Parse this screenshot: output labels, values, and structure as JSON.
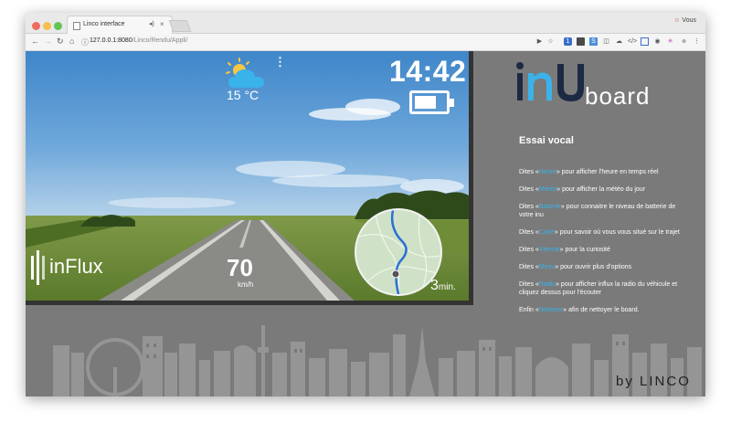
{
  "browser": {
    "tab_title": "Linco interface",
    "profile_label": "Vous",
    "url_host": "127.0.0.1:8080",
    "url_path": "/Linco/Rendu/Appli/"
  },
  "video": {
    "temperature": "15 °C",
    "clock": "14:42",
    "battery_level": 0.72,
    "speed": "70",
    "speed_unit": "km/h",
    "app_name": "inFlux",
    "eta_value": "3",
    "eta_unit": "min.",
    "weather_icon": "partly-cloudy-icon"
  },
  "sidebar": {
    "brand_suffix": "board",
    "title": "Essai vocal",
    "commands": [
      {
        "pre": "Dites «",
        "kw": "Heure",
        "post": "» pour afficher l'heure en temps réel"
      },
      {
        "pre": "Dites «",
        "kw": "Météo",
        "post": "» pour afficher la météo du jour"
      },
      {
        "pre": "Dites «",
        "kw": "Batterie",
        "post": "» pour connaitre le niveau de batterie de votre inu"
      },
      {
        "pre": "Dites «",
        "kw": "Carte",
        "post": "» pour savoir où vous vous situé sur le trajet"
      },
      {
        "pre": "Dites «",
        "kw": "Vitesse",
        "post": "» pour la curiosité"
      },
      {
        "pre": "Dites «",
        "kw": "Menu",
        "post": "» pour ouvrir plus d'options"
      },
      {
        "pre": "Dites «",
        "kw": "Radio",
        "post": "» pour afficher influx la radio du véhicule et cliquez dessus pour l'écouter"
      },
      {
        "pre": "Enfin «",
        "kw": "Nettoyer",
        "post": "» afin de nettoyer le board."
      }
    ]
  },
  "footer": {
    "by": "by",
    "company": "LINCO"
  },
  "colors": {
    "accent": "#3ab2ea",
    "background": "#7a7a7a",
    "brand_blue": "#3ab2ea",
    "brand_dark": "#1c2a44"
  }
}
